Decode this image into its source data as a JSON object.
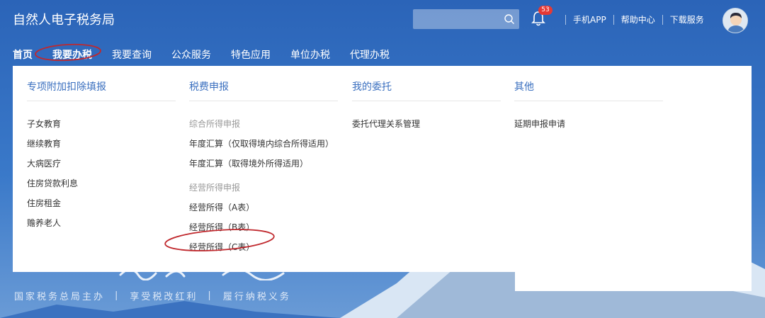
{
  "header": {
    "site_title": "自然人电子税务局",
    "search_placeholder": "",
    "notification_count": "53",
    "links": [
      "手机APP",
      "帮助中心",
      "下载服务"
    ]
  },
  "nav": {
    "items": [
      "首页",
      "我要办税",
      "我要查询",
      "公众服务",
      "特色应用",
      "单位办税",
      "代理办税"
    ]
  },
  "dropdown": {
    "col1": {
      "title": "专项附加扣除填报",
      "items": [
        "子女教育",
        "继续教育",
        "大病医疗",
        "住房贷款利息",
        "住房租金",
        "赡养老人"
      ]
    },
    "col2": {
      "title": "税费申报",
      "group1_head": "综合所得申报",
      "group1_items": [
        "年度汇算（仅取得境内综合所得适用）",
        "年度汇算（取得境外所得适用）"
      ],
      "group2_head": "经营所得申报",
      "group2_items": [
        "经营所得（A表）",
        "经营所得（B表）",
        "经营所得（C表）"
      ]
    },
    "col3": {
      "title": "我的委托",
      "items": [
        "委托代理关系管理"
      ]
    },
    "col4": {
      "title": "其他",
      "items": [
        "延期申报申请"
      ]
    }
  },
  "footer": {
    "slogan": [
      "国家税务总局主办",
      "享受税改红利",
      "履行纳税义务"
    ]
  },
  "colors": {
    "accent_blue": "#3a6fbf",
    "header_bg": "#2b64b8",
    "annotation_red": "#c0282d",
    "badge_red": "#e53935"
  }
}
